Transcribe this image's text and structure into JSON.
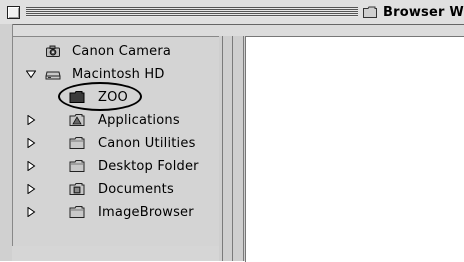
{
  "window": {
    "title": "Browser Wi"
  },
  "tree": {
    "items": [
      {
        "label": "Canon Camera",
        "icon": "camera-icon",
        "triangle": "none"
      },
      {
        "label": "Macintosh HD",
        "icon": "hard-disk-icon",
        "triangle": "down"
      },
      {
        "label": "ZOO",
        "icon": "folder-icon",
        "triangle": "none"
      },
      {
        "label": "Applications",
        "icon": "applications-folder-icon",
        "triangle": "right"
      },
      {
        "label": "Canon Utilities",
        "icon": "folder-icon",
        "triangle": "right"
      },
      {
        "label": "Desktop Folder",
        "icon": "folder-icon",
        "triangle": "right"
      },
      {
        "label": "Documents",
        "icon": "documents-folder-icon",
        "triangle": "right"
      },
      {
        "label": "ImageBrowser",
        "icon": "folder-icon",
        "triangle": "right"
      }
    ]
  }
}
